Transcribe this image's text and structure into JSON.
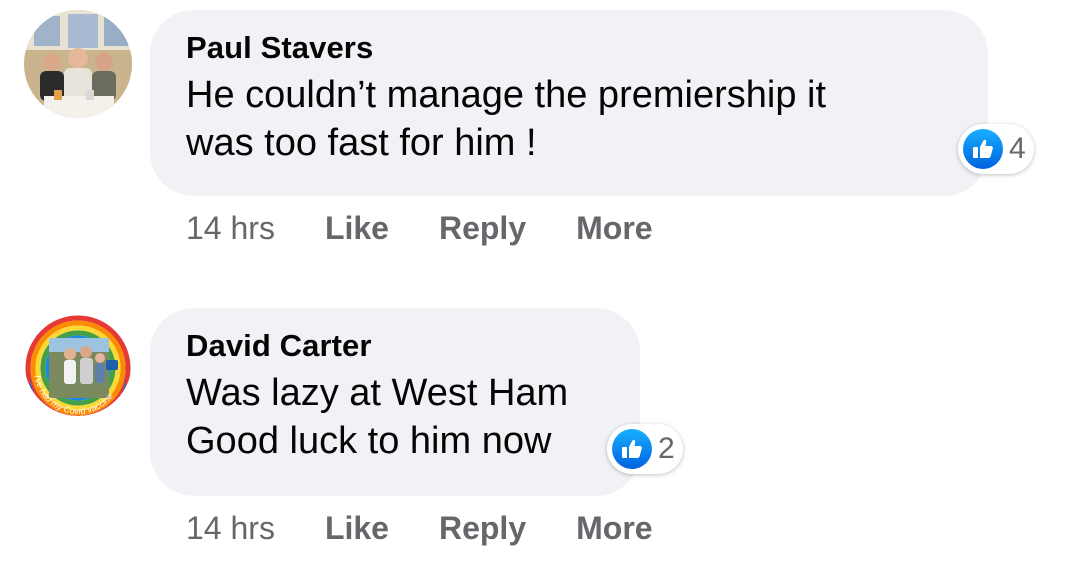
{
  "comments": [
    {
      "author": "Paul Stavers",
      "text": "He couldn’t manage the premiership it\nwas too fast for him !",
      "reactions": "4",
      "time": "14 hrs",
      "like_label": "Like",
      "reply_label": "Reply",
      "more_label": "More"
    },
    {
      "author": "David Carter",
      "text": "Was lazy at West Ham\nGood luck to him now",
      "reactions": "2",
      "time": "14 hrs",
      "like_label": "Like",
      "reply_label": "Reply",
      "more_label": "More",
      "avatar_frame_text": "I've had my Covid vaccine"
    }
  ],
  "colors": {
    "bubble": "#f0f2f5",
    "secondary_text": "#65676b",
    "like_blue": "#1877f2"
  }
}
